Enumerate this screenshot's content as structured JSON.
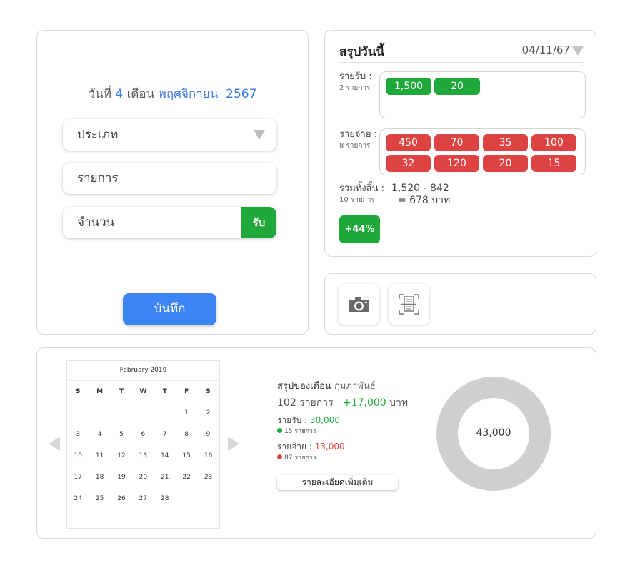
{
  "entry": {
    "date_prefix": "วันที่",
    "day": "4",
    "month_word": "เดือน",
    "month_name": "พฤศจิกายน",
    "year": "2567",
    "type_placeholder": "ประเภท",
    "item_placeholder": "รายการ",
    "amount_placeholder": "จำนวน",
    "income_toggle_label": "รับ",
    "save_label": "บันทึก"
  },
  "today": {
    "title": "สรุปวันนี้",
    "date": "04/11/67",
    "income_label": "รายรับ :",
    "income_count": "2 รายการ",
    "income_amounts": [
      "1,500",
      "20"
    ],
    "expense_label": "รายจ่าย :",
    "expense_count": "8 รายการ",
    "expense_amounts": [
      "450",
      "70",
      "35",
      "100",
      "32",
      "120",
      "20",
      "15"
    ],
    "total_label": "รวมทั้งสิ้น :",
    "total_count": "10 รายการ",
    "total_formula": "1,520 - 842",
    "total_result": "= 678 บาท",
    "percent_badge": "+44%"
  },
  "tools": {
    "camera_icon": "camera-icon",
    "scan_icon": "document-scan-icon"
  },
  "month": {
    "calendar": {
      "title": "February 2019",
      "weekdays": [
        "S",
        "M",
        "T",
        "W",
        "T",
        "F",
        "S"
      ],
      "days": [
        "",
        "",
        "",
        "",
        "",
        "1",
        "2",
        "3",
        "4",
        "5",
        "6",
        "7",
        "8",
        "9",
        "10",
        "11",
        "12",
        "13",
        "14",
        "15",
        "16",
        "17",
        "18",
        "19",
        "20",
        "21",
        "22",
        "23",
        "24",
        "25",
        "26",
        "27",
        "28",
        "",
        ""
      ]
    },
    "summary_label": "สรุปของเดือน",
    "month_name": "กุมภาพันธ์",
    "count_text": "102 รายการ",
    "net_amount": "+17,000",
    "net_unit": "บาท",
    "income_label": "รายรับ :",
    "income_value": "30,000",
    "income_count": "15 รายการ",
    "expense_label": "รายจ่าย :",
    "expense_value": "13,000",
    "expense_count": "87 รายการ",
    "detail_button": "รายละเอียดเพิ่มเติม",
    "donut_value": "43,000"
  },
  "colors": {
    "accent_blue": "#3d85f5",
    "income_green": "#1fa83a",
    "expense_red": "#de4343",
    "donut_gray": "#cfcfcf"
  }
}
